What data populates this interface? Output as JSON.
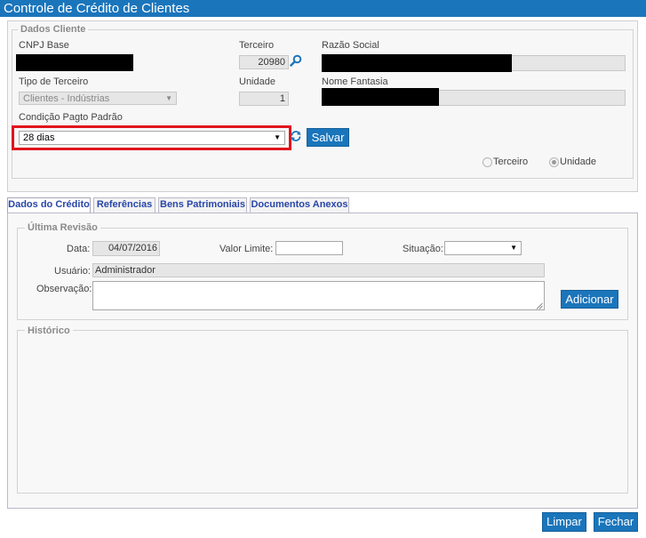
{
  "window": {
    "title": "Controle de Crédito de Clientes"
  },
  "dados_cliente": {
    "legend": "Dados Cliente",
    "cnpj_label": "CNPJ Base",
    "terceiro_label": "Terceiro",
    "terceiro_value": "20980",
    "razao_label": "Razão Social",
    "tipo_label": "Tipo de Terceiro",
    "tipo_value": "Clientes - Indústrias",
    "unidade_label": "Unidade",
    "unidade_value": "1",
    "nome_fantasia_label": "Nome Fantasia",
    "condicao_label": "Condição Pagto Padrão",
    "condicao_value": "28 dias",
    "salvar_label": "Salvar",
    "radio_terceiro": "Terceiro",
    "radio_unidade": "Unidade",
    "highlight_color": "#e1141e"
  },
  "tabs": [
    {
      "label": "Dados do Crédito"
    },
    {
      "label": "Referências"
    },
    {
      "label": "Bens Patrimoniais"
    },
    {
      "label": "Documentos Anexos"
    }
  ],
  "ultima_revisao": {
    "legend": "Última Revisão",
    "data_label": "Data:",
    "data_value": "04/07/2016",
    "valor_limite_label": "Valor Limite:",
    "valor_limite_value": "",
    "situacao_label": "Situação:",
    "situacao_value": "",
    "usuario_label": "Usuário:",
    "usuario_value": "Administrador",
    "observacao_label": "Observação:",
    "observacao_value": "",
    "adicionar_label": "Adicionar"
  },
  "historico": {
    "legend": "Histórico"
  },
  "footer": {
    "limpar_label": "Limpar",
    "fechar_label": "Fechar"
  },
  "colors": {
    "accent": "#1b75bb"
  }
}
